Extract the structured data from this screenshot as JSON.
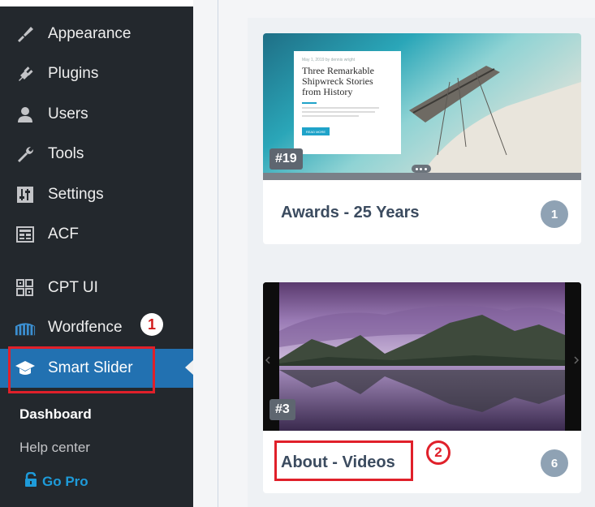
{
  "sidebar": {
    "items": [
      {
        "label": "Appearance",
        "icon": "paintbrush-icon"
      },
      {
        "label": "Plugins",
        "icon": "plug-icon"
      },
      {
        "label": "Users",
        "icon": "user-icon"
      },
      {
        "label": "Tools",
        "icon": "wrench-icon"
      },
      {
        "label": "Settings",
        "icon": "settings-sliders-icon"
      },
      {
        "label": "ACF",
        "icon": "acf-icon"
      },
      {
        "label": "CPT UI",
        "icon": "grid-icon"
      },
      {
        "label": "Wordfence",
        "icon": "wordfence-icon"
      },
      {
        "label": "Smart Slider",
        "icon": "graduation-cap-icon"
      }
    ],
    "submenu": {
      "dashboard": "Dashboard",
      "help": "Help center",
      "gopro": "Go Pro"
    }
  },
  "annotations": {
    "step1": "1",
    "step2": "2"
  },
  "sliders": [
    {
      "id_label": "#19",
      "title": "Awards - 25 Years",
      "count": "1",
      "preview": {
        "meta": "May 1, 2019 by  dennis wright",
        "heading": "Three Remarkable Shipwreck Stories from History",
        "button": "READ MORE"
      }
    },
    {
      "id_label": "#3",
      "title": "About - Videos",
      "count": "6"
    }
  ],
  "colors": {
    "sidebar_bg": "#23282d",
    "active_bg": "#2271b1",
    "annotation_red": "#e0202a",
    "gopro": "#1e9bd9"
  }
}
